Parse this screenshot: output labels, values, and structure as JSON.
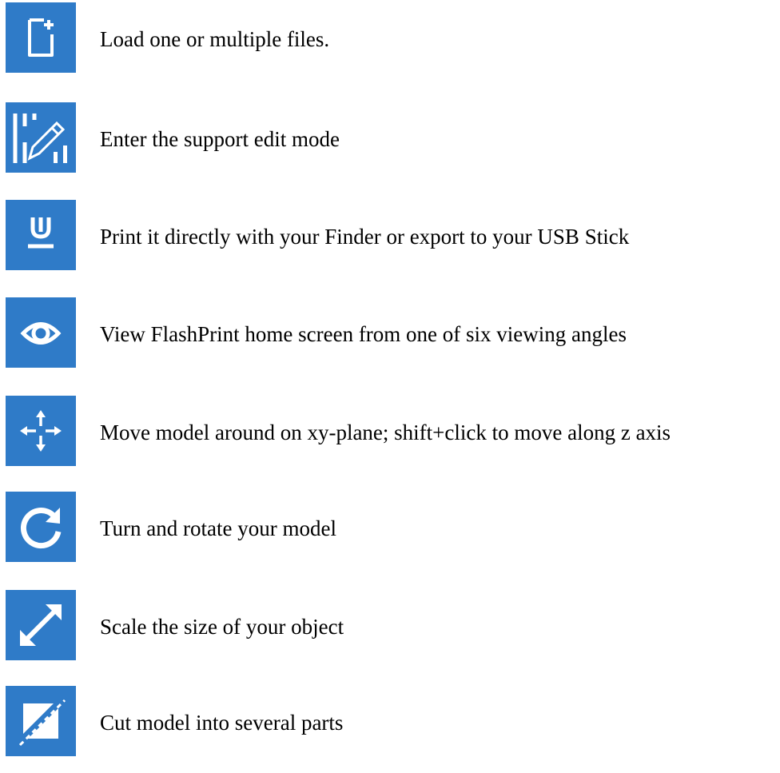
{
  "colors": {
    "tile": "#2f7bc8",
    "glyph": "#ffffff",
    "text": "#000000"
  },
  "items": [
    {
      "icon": "new-file-icon",
      "label": "Load one or multiple files."
    },
    {
      "icon": "support-edit-icon",
      "label": "Enter the support edit mode"
    },
    {
      "icon": "print-icon",
      "label": "Print it directly with your Finder or export to your USB Stick"
    },
    {
      "icon": "eye-icon",
      "label": "View FlashPrint home screen from one of six viewing angles"
    },
    {
      "icon": "move-icon",
      "label": "Move model around on xy-plane; shift+click to move along z axis"
    },
    {
      "icon": "rotate-icon",
      "label": "Turn and rotate your model"
    },
    {
      "icon": "scale-icon",
      "label": "Scale the size of your object"
    },
    {
      "icon": "cut-icon",
      "label": "Cut model into several parts"
    }
  ]
}
